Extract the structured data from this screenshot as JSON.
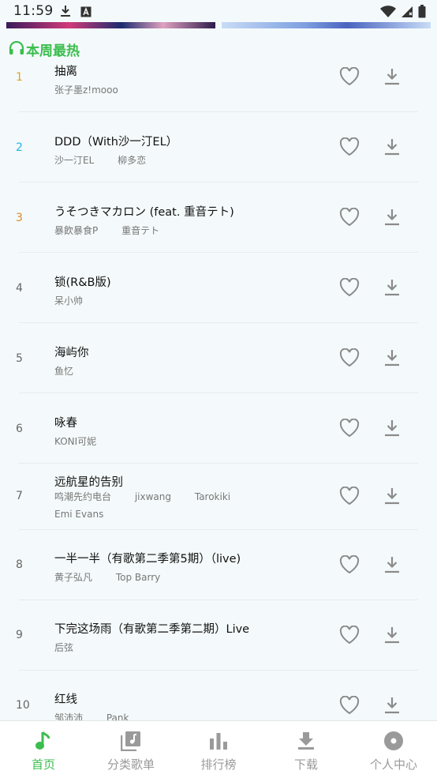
{
  "status_bar": {
    "time": "11:59"
  },
  "section": {
    "title": "本周最热"
  },
  "colors": {
    "accent": "#3cbd4f",
    "rank1": "#e0a11b",
    "rank2": "#1fb6e8",
    "rank3": "#d98a2b"
  },
  "songs": [
    {
      "rank": "1",
      "title": "抽离",
      "artists": [
        "张子墨z!mooo"
      ],
      "artists_line2": []
    },
    {
      "rank": "2",
      "title": "DDD（With沙一汀EL）",
      "artists": [
        "沙一汀EL",
        "柳多恋"
      ],
      "artists_line2": []
    },
    {
      "rank": "3",
      "title": "うそつきマカロン (feat. 重音テト)",
      "artists": [
        "暴飮暴食P",
        "重音テト"
      ],
      "artists_line2": []
    },
    {
      "rank": "4",
      "title": "锁(R&B版)",
      "artists": [
        "呆小帅"
      ],
      "artists_line2": []
    },
    {
      "rank": "5",
      "title": "海屿你",
      "artists": [
        "鱼忆"
      ],
      "artists_line2": []
    },
    {
      "rank": "6",
      "title": "咏春",
      "artists": [
        "KONI可妮"
      ],
      "artists_line2": []
    },
    {
      "rank": "7",
      "title": "远航星的告别",
      "artists": [
        "鸣潮先约电台",
        "jixwang",
        "Tarokiki"
      ],
      "artists_line2": [
        "Emi Evans"
      ]
    },
    {
      "rank": "8",
      "title": "一半一半（有歌第二季第5期）（live)",
      "artists": [
        "黄子弘凡",
        "Top Barry"
      ],
      "artists_line2": []
    },
    {
      "rank": "9",
      "title": "下完这场雨（有歌第二季第二期）Live",
      "artists": [
        "后弦"
      ],
      "artists_line2": []
    },
    {
      "rank": "10",
      "title": "红线",
      "artists": [
        "邹沛沛",
        "Pank"
      ],
      "artists_line2": []
    }
  ],
  "bottom_nav": [
    {
      "label": "首页",
      "icon": "music-note-icon",
      "active": true
    },
    {
      "label": "分类歌单",
      "icon": "playlist-icon",
      "active": false
    },
    {
      "label": "排行榜",
      "icon": "bar-chart-icon",
      "active": false
    },
    {
      "label": "下载",
      "icon": "download-icon",
      "active": false
    },
    {
      "label": "个人中心",
      "icon": "disc-icon",
      "active": false
    }
  ]
}
